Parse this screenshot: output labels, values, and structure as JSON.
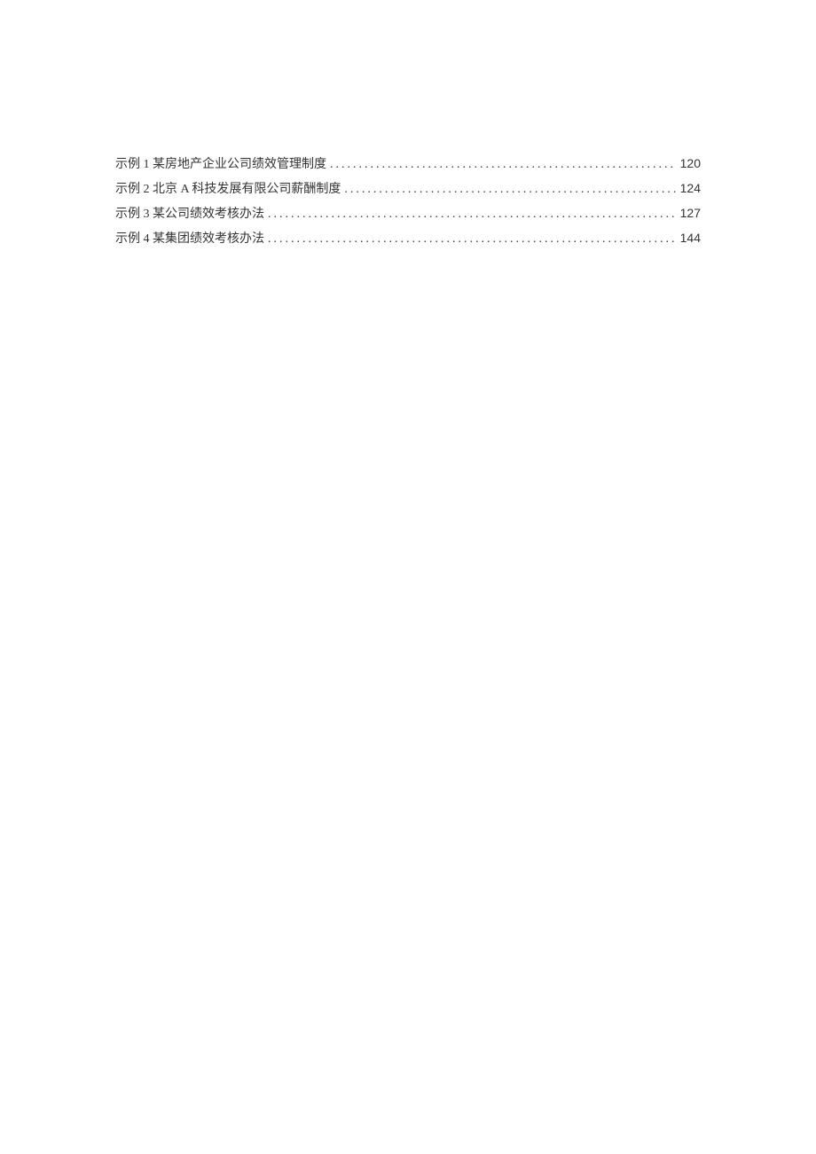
{
  "toc": {
    "entries": [
      {
        "title": "示例 1 某房地产企业公司绩效管理制度",
        "page": "120"
      },
      {
        "title": "示例 2 北京 A 科技发展有限公司薪酬制度",
        "page": "124"
      },
      {
        "title": "示例 3 某公司绩效考核办法",
        "page": "127"
      },
      {
        "title": "示例 4 某集团绩效考核办法",
        "page": "144"
      }
    ]
  }
}
